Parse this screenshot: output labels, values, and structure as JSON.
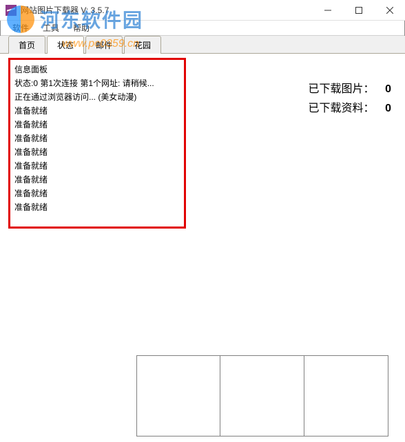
{
  "watermark": {
    "text": "河东软件园",
    "url": "www.pc0359.cn"
  },
  "window": {
    "title": "网站图片下载器 V: 3.5.7"
  },
  "menu": {
    "items": [
      "软件",
      "工具",
      "帮助"
    ]
  },
  "tabs": {
    "items": [
      "首页",
      "状态",
      "邮件",
      "花园"
    ],
    "active_index": 1
  },
  "info_panel": {
    "header": "信息面板",
    "lines": [
      "状态:0 第1次连接 第1个网址: 请稍候...",
      "正在通过浏览器访问... (美女动漫)",
      "准备就绪",
      "准备就绪",
      "准备就绪",
      "准备就绪",
      "准备就绪",
      "准备就绪",
      "准备就绪",
      "准备就绪"
    ]
  },
  "stats": {
    "images_label": "已下载图片：",
    "images_value": "0",
    "data_label": "已下载资料：",
    "data_value": "0"
  }
}
